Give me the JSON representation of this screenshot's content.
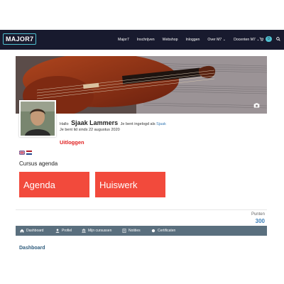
{
  "header": {
    "logo_text": "MAJOR7",
    "menu": [
      {
        "label": "Major7"
      },
      {
        "label": "Inschrijven"
      },
      {
        "label": "Webshop"
      },
      {
        "label": "Inloggen"
      },
      {
        "label": "Over M7 ⌄"
      },
      {
        "label": "Docenten M7 ⌄"
      }
    ],
    "cart_count": "0",
    "colors": {
      "nav_bg": "#181a2e",
      "accent": "#4fc0d0"
    }
  },
  "profile": {
    "hello": "Hallo",
    "name": "Sjaak  Lammers",
    "logged_in_as": "Je bent ingelogd als",
    "username": "Sjaak",
    "member_since": "Je bent lid sinds 22 augustus 2020",
    "logout_label": "Uitloggen"
  },
  "agenda": {
    "title": "Cursus agenda",
    "tiles": [
      {
        "label": "Agenda"
      },
      {
        "label": "Huiswerk"
      }
    ],
    "tile_color": "#f24a3c"
  },
  "points": {
    "label": "Punten",
    "value": "300"
  },
  "subnav": {
    "items": [
      {
        "label": "Dashboard",
        "icon": "home-icon"
      },
      {
        "label": "Profiel",
        "icon": "user-icon"
      },
      {
        "label": "Mijn cursussen",
        "icon": "bank-icon"
      },
      {
        "label": "Notities",
        "icon": "note-icon"
      },
      {
        "label": "Certificaten",
        "icon": "circle-icon"
      }
    ],
    "bg_color": "#5a6f7e"
  },
  "section_title": "Dashboard"
}
